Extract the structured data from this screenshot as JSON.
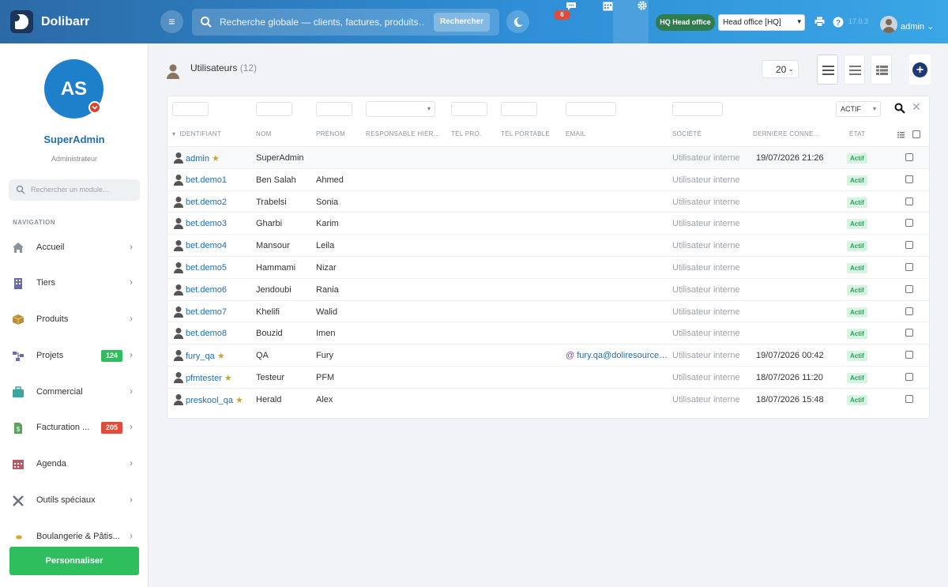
{
  "topbar": {
    "brand": "Dolibarr",
    "search_placeholder": "Recherche globale — clients, factures, produits…",
    "search_button": "Rechercher",
    "notifications_count": "6",
    "hq_badge_prefix": "HQ",
    "hq_badge_label": "Head office",
    "entity_select": "Head office [HQ]",
    "version": "17.0.3",
    "username": "admin"
  },
  "sidebar": {
    "avatar_initials": "AS",
    "user_name": "SuperAdmin",
    "user_role": "Administrateur",
    "module_search_placeholder": "Rechercher un module…",
    "nav_title": "NAVIGATION",
    "items": [
      {
        "label": "Accueil",
        "icon": "home-icon",
        "badge": ""
      },
      {
        "label": "Tiers",
        "icon": "building-icon",
        "badge": ""
      },
      {
        "label": "Produits",
        "icon": "box-icon",
        "badge": ""
      },
      {
        "label": "Projets",
        "icon": "project-icon",
        "badge": "124"
      },
      {
        "label": "Commercial",
        "icon": "briefcase-icon",
        "badge": ""
      },
      {
        "label": "Facturation ...",
        "icon": "invoice-icon",
        "badge": "205"
      },
      {
        "label": "Agenda",
        "icon": "calendar-icon",
        "badge": ""
      },
      {
        "label": "Outils spéciaux",
        "icon": "tools-icon",
        "badge": ""
      },
      {
        "label": "Boulangerie & Pâtis...",
        "icon": "bakery-icon",
        "badge": ""
      }
    ],
    "personalize_button": "Personnaliser",
    "colors": {
      "projets_badge": "#2ebe5e",
      "facturation_badge": "#e04b3a"
    }
  },
  "main": {
    "title": "Utilisateurs",
    "count": "(12)",
    "limit": "20",
    "status_filter": "ACTIF",
    "columns": [
      "IDENTIFIANT",
      "NOM",
      "PRÉNOM",
      "RESPONSABLE HIÉR...",
      "TÉL PRO.",
      "TÉL PORTABLE",
      "EMAIL",
      "SOCIÉTÉ",
      "DERNIÈRE CONNE...",
      "ÉTAT"
    ],
    "rows": [
      {
        "login": "admin",
        "star": true,
        "nom": "SuperAdmin",
        "prenom": "",
        "email": "",
        "societe": "Utilisateur interne",
        "last": "19/07/2026 21:26",
        "etat": "Actif"
      },
      {
        "login": "bet.demo1",
        "star": false,
        "nom": "Ben Salah",
        "prenom": "Ahmed",
        "email": "",
        "societe": "Utilisateur interne",
        "last": "",
        "etat": "Actif"
      },
      {
        "login": "bet.demo2",
        "star": false,
        "nom": "Trabelsi",
        "prenom": "Sonia",
        "email": "",
        "societe": "Utilisateur interne",
        "last": "",
        "etat": "Actif"
      },
      {
        "login": "bet.demo3",
        "star": false,
        "nom": "Gharbi",
        "prenom": "Karim",
        "email": "",
        "societe": "Utilisateur interne",
        "last": "",
        "etat": "Actif"
      },
      {
        "login": "bet.demo4",
        "star": false,
        "nom": "Mansour",
        "prenom": "Leila",
        "email": "",
        "societe": "Utilisateur interne",
        "last": "",
        "etat": "Actif"
      },
      {
        "login": "bet.demo5",
        "star": false,
        "nom": "Hammami",
        "prenom": "Nizar",
        "email": "",
        "societe": "Utilisateur interne",
        "last": "",
        "etat": "Actif"
      },
      {
        "login": "bet.demo6",
        "star": false,
        "nom": "Jendoubi",
        "prenom": "Rania",
        "email": "",
        "societe": "Utilisateur interne",
        "last": "",
        "etat": "Actif"
      },
      {
        "login": "bet.demo7",
        "star": false,
        "nom": "Khelifi",
        "prenom": "Walid",
        "email": "",
        "societe": "Utilisateur interne",
        "last": "",
        "etat": "Actif"
      },
      {
        "login": "bet.demo8",
        "star": false,
        "nom": "Bouzid",
        "prenom": "Imen",
        "email": "",
        "societe": "Utilisateur interne",
        "last": "",
        "etat": "Actif"
      },
      {
        "login": "fury_qa",
        "star": true,
        "nom": "QA",
        "prenom": "Fury",
        "email": "fury.qa@doliresource…",
        "societe": "Utilisateur interne",
        "last": "19/07/2026 00:42",
        "etat": "Actif"
      },
      {
        "login": "pfmtester",
        "star": true,
        "nom": "Testeur",
        "prenom": "PFM",
        "email": "",
        "societe": "Utilisateur interne",
        "last": "18/07/2026 11:20",
        "etat": "Actif"
      },
      {
        "login": "preskool_qa",
        "star": true,
        "nom": "Herald",
        "prenom": "Alex",
        "email": "",
        "societe": "Utilisateur interne",
        "last": "18/07/2026 15:48",
        "etat": "Actif"
      }
    ]
  }
}
